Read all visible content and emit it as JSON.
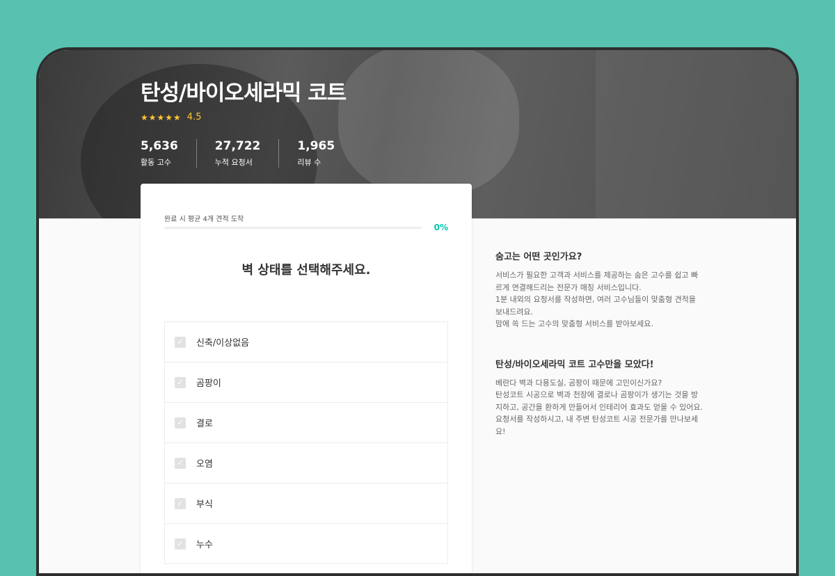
{
  "hero": {
    "title": "탄성/바이오세라믹 코트",
    "rating": {
      "stars": "★★★★★",
      "value": "4.5"
    },
    "stats": [
      {
        "value": "5,636",
        "label": "활동 고수"
      },
      {
        "value": "27,722",
        "label": "누적 요청서"
      },
      {
        "value": "1,965",
        "label": "리뷰 수"
      }
    ]
  },
  "form": {
    "progress_label": "완료 시 평균 4개 견적 도착",
    "progress_percent": "0%",
    "progress_fraction": 0,
    "question": "벽 상태를 선택해주세요.",
    "options": [
      "신축/이상없음",
      "곰팡이",
      "결로",
      "오염",
      "부식",
      "누수"
    ],
    "check_glyph": "✓"
  },
  "sidebar": {
    "section1": {
      "title": "숨고는 어떤 곳인가요?",
      "body": "서비스가 필요한 고객과 서비스를 제공하는 숨은 고수를 쉽고 빠\n르게 연결해드리는 전문가 매칭 서비스입니다.\n1분 내외의 요청서를 작성하면, 여러 고수님들이 맞춤형 견적을\n보내드려요.\n맘에 쏙 드는 고수의 맞춤형 서비스를 받아보세요."
    },
    "section2": {
      "title": "탄성/바이오세라믹 코트 고수만을 모았다!",
      "body": "베란다 벽과 다용도실, 곰팡이 때문에 고민이신가요?\n탄성코트 시공으로 벽과 천장에 결로나 곰팡이가 생기는 것을 방\n지하고, 공간을 환하게 만들어서 인테리어 효과도 얻을 수 있어요.\n요청서를 작성하시고, 내 주변 탄성코트 시공 전문가를 만나보세\n요!"
    }
  },
  "colors": {
    "background": "#58c1b0",
    "accent": "#00c7ae",
    "star": "#ffc633"
  }
}
